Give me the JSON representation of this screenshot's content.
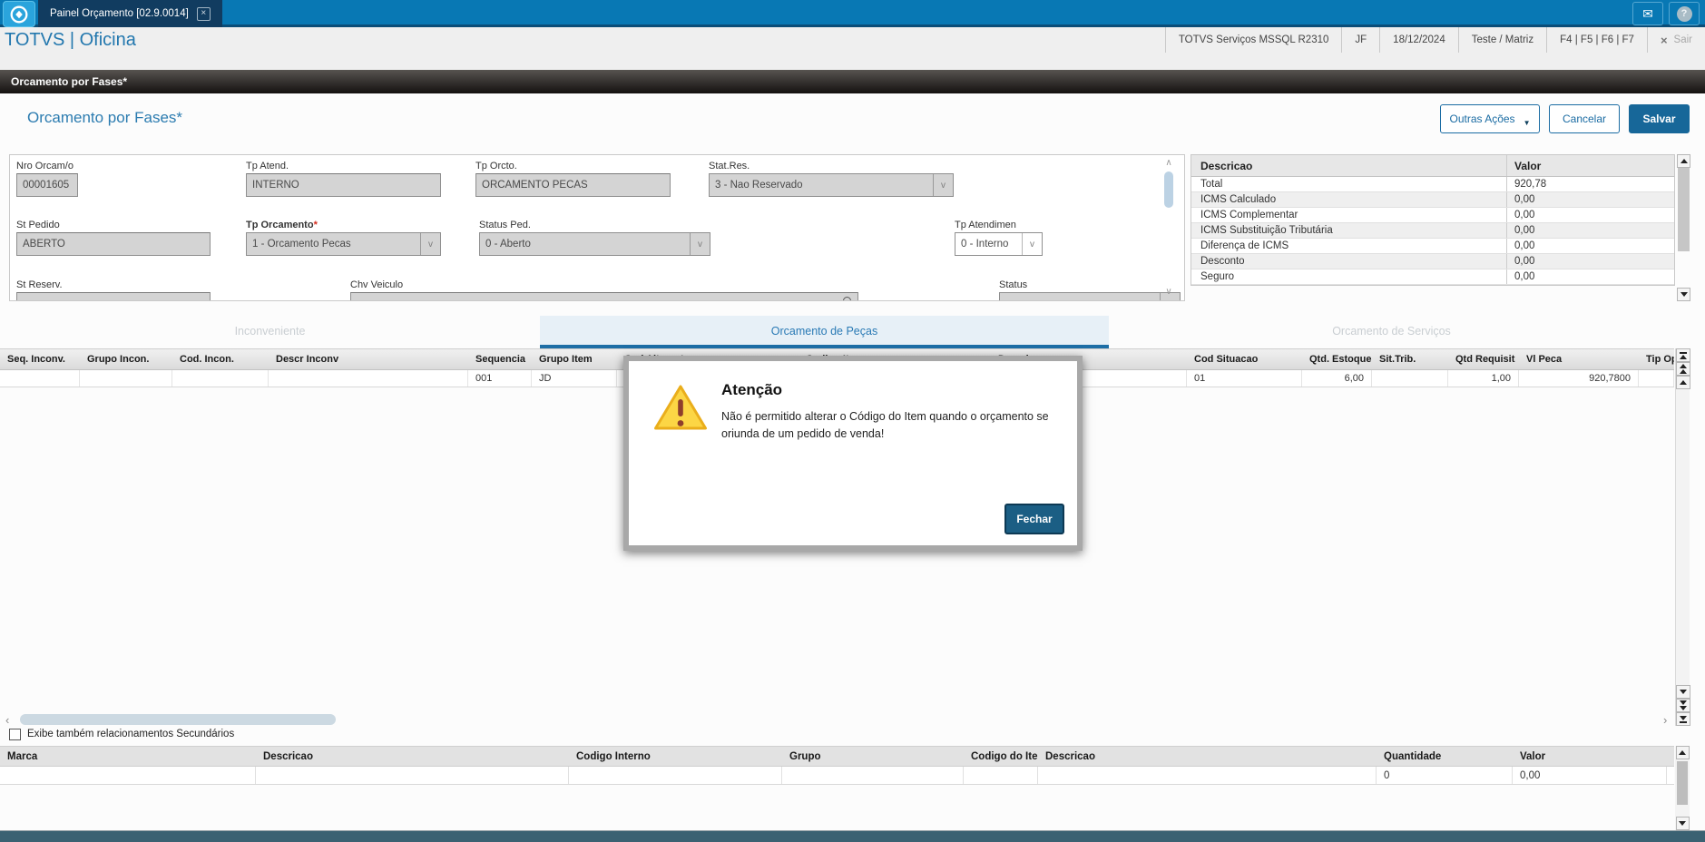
{
  "icons": {
    "close": "×",
    "envelope": "✉",
    "help": "?",
    "select_arrow": "v",
    "chevron_up": "∧",
    "chevron_down": "∨",
    "arrow_left": "‹",
    "arrow_right": "›"
  },
  "topbar": {
    "tab_title": "Painel Orçamento [02.9.0014]"
  },
  "infobar": {
    "brand": "TOTVS | Oficina",
    "items": [
      "TOTVS Serviços MSSQL R2310",
      "JF",
      "18/12/2024",
      "Teste / Matriz",
      "F4 | F5 | F6 | F7"
    ],
    "sair": "Sair"
  },
  "breadcrumb": {
    "title": "Orcamento por Fases*"
  },
  "page": {
    "title": "Orcamento por Fases*",
    "actions": {
      "outras_acoes": "Outras Ações",
      "cancelar": "Cancelar",
      "salvar": "Salvar"
    }
  },
  "form": {
    "nro_orcam": {
      "label": "Nro Orcam/o",
      "value": "00001605"
    },
    "tp_atend": {
      "label": "Tp Atend.",
      "value": "INTERNO"
    },
    "tp_orcto": {
      "label": "Tp Orcto.",
      "value": "ORCAMENTO PECAS"
    },
    "stat_res": {
      "label": "Stat.Res.",
      "value": "3 - Nao Reservado"
    },
    "st_pedido": {
      "label": "St Pedido",
      "value": "ABERTO"
    },
    "tp_orcamento": {
      "label": "Tp Orcamento",
      "required_mark": "*",
      "value": "1 - Orcamento Pecas"
    },
    "status_ped": {
      "label": "Status Ped.",
      "value": "0 - Aberto"
    },
    "tp_atendimen": {
      "label": "Tp Atendimen",
      "value": "0 - Interno"
    },
    "st_reserv": {
      "label": "St Reserv.",
      "value": ""
    },
    "chv_veiculo": {
      "label": "Chv Veiculo",
      "value": ""
    },
    "status": {
      "label": "Status",
      "value": ""
    }
  },
  "summary": {
    "col_desc": "Descricao",
    "col_valor": "Valor",
    "rows": [
      {
        "label": "Total",
        "value": "920,78"
      },
      {
        "label": "ICMS Calculado",
        "value": "0,00"
      },
      {
        "label": "ICMS Complementar",
        "value": "0,00"
      },
      {
        "label": "ICMS Substituição Tributária",
        "value": "0,00"
      },
      {
        "label": "Diferença de ICMS",
        "value": "0,00"
      },
      {
        "label": "Desconto",
        "value": "0,00"
      },
      {
        "label": "Seguro",
        "value": "0,00"
      }
    ]
  },
  "tabs": {
    "inconveniente": "Inconveniente",
    "orcamento_pecas": "Orcamento de Peças",
    "orcamento_servicos": "Orcamento de Serviços"
  },
  "grid": {
    "columns": [
      "Seq. Inconv.",
      "Grupo Incon.",
      "Cod. Incon.",
      "Descr Inconv",
      "Sequencia",
      "Grupo Item",
      "Cod Alternat",
      "Codigo Item",
      "Descricao",
      "Cod Situacao",
      "Qtd. Estoque",
      "Sit.Trib.",
      "Qtd Requisit",
      "Vl Peca",
      "Tip Op"
    ],
    "row_values": [
      "",
      "",
      "",
      "",
      "001",
      "JD",
      "",
      "",
      "",
      "01",
      "6,00",
      "",
      "1,00",
      "920,7800",
      ""
    ]
  },
  "modal": {
    "title": "Atenção",
    "message": "Não é permitido alterar o Código do Item quando o orçamento se oriunda de um pedido de venda!",
    "close_label": "Fechar"
  },
  "bottom": {
    "checkbox_label": "Exibe também relacionamentos Secundários",
    "columns": [
      "Marca",
      "Descricao",
      "Codigo Interno",
      "Grupo",
      "Codigo do Item",
      "Descricao",
      "Quantidade",
      "Valor"
    ],
    "row_values": [
      "",
      "",
      "",
      "",
      "",
      "",
      "0",
      "0,00"
    ]
  }
}
